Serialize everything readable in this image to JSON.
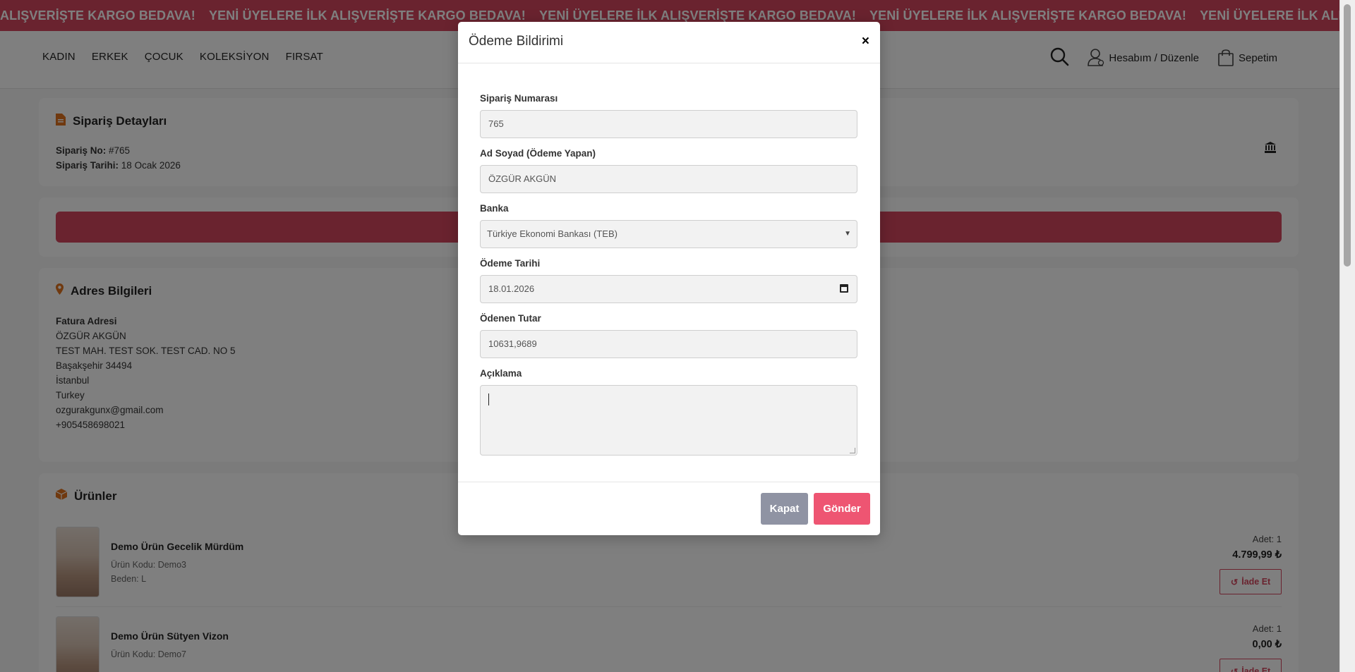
{
  "announcement": {
    "text": "YENİ ÜYELERE İLK ALIŞVERİŞTE KARGO BEDAVA!",
    "leading_text": "ALIŞVERİŞTE KARGO BEDAVA!"
  },
  "nav": {
    "items": [
      "KADIN",
      "ERKEK",
      "ÇOCUK",
      "KOLEKSİYON",
      "FIRSAT"
    ]
  },
  "header": {
    "account_label": "Hesabım / Düzenle",
    "cart_label": "Sepetim"
  },
  "order": {
    "title": "Sipariş Detayları",
    "no_label": "Sipariş No:",
    "no_value": "#765",
    "date_label": "Sipariş Tarihi:",
    "date_value": "18 Ocak 2026"
  },
  "address": {
    "title": "Adres Bilgileri",
    "heading": "Fatura Adresi",
    "lines": [
      "ÖZGÜR AKGÜN",
      "TEST MAH. TEST SOK. TEST CAD. NO 5",
      "Başakşehir 34494",
      "İstanbul",
      "Turkey",
      "ozgurakgunx@gmail.com",
      "+905458698021"
    ]
  },
  "products": {
    "title": "Ürünler",
    "items": [
      {
        "name": "Demo Ürün Gecelik Mürdüm",
        "code": "Ürün Kodu: Demo3",
        "size": "Beden: L",
        "qty": "Adet: 1",
        "price": "4.799,99 ₺",
        "return_label": "İade Et"
      },
      {
        "name": "Demo Ürün Sütyen Vizon",
        "code": "Ürün Kodu: Demo7",
        "size": "",
        "qty": "Adet: 1",
        "price": "0,00 ₺",
        "return_label": "İade Et"
      }
    ]
  },
  "modal": {
    "title": "Ödeme Bildirimi",
    "close_symbol": "×",
    "fields": {
      "order_no": {
        "label": "Sipariş Numarası",
        "value": "765"
      },
      "name": {
        "label": "Ad Soyad (Ödeme Yapan)",
        "value": "ÖZGÜR AKGÜN"
      },
      "bank": {
        "label": "Banka",
        "value": "Türkiye Ekonomi Bankası (TEB)"
      },
      "date": {
        "label": "Ödeme Tarihi",
        "value": "18.01.2026"
      },
      "amount": {
        "label": "Ödenen Tutar",
        "value": "10631,9689"
      },
      "desc": {
        "label": "Açıklama",
        "value": ""
      }
    },
    "close_label": "Kapat",
    "send_label": "Gönder"
  },
  "colors": {
    "brand_red": "#d4475e",
    "send_button": "#ee5572",
    "close_button": "#8f93a3"
  }
}
